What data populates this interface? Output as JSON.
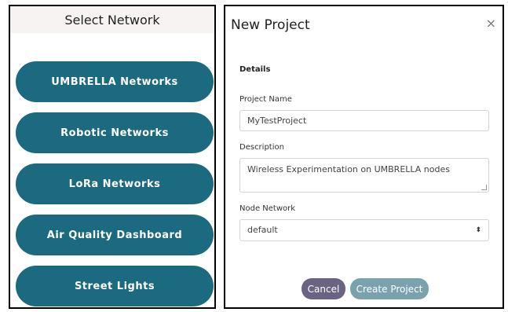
{
  "left": {
    "header": "Select Network",
    "buttons": [
      "UMBRELLA Networks",
      "Robotic Networks",
      "LoRa Networks",
      "Air Quality Dashboard",
      "Street Lights"
    ]
  },
  "modal": {
    "title": "New Project",
    "close_glyph": "×",
    "section": "Details",
    "project_name": {
      "label": "Project Name",
      "value": "MyTestProject"
    },
    "description": {
      "label": "Description",
      "value": "Wireless Experimentation on UMBRELLA nodes"
    },
    "node_network": {
      "label": "Node Network",
      "value": "default",
      "arrow_glyph": "⬍"
    },
    "cancel_label": "Cancel",
    "create_label": "Create Project"
  },
  "colors": {
    "network_button": "#1c6a80",
    "cancel_button": "#6a6384",
    "create_button": "#7aa2ad"
  }
}
